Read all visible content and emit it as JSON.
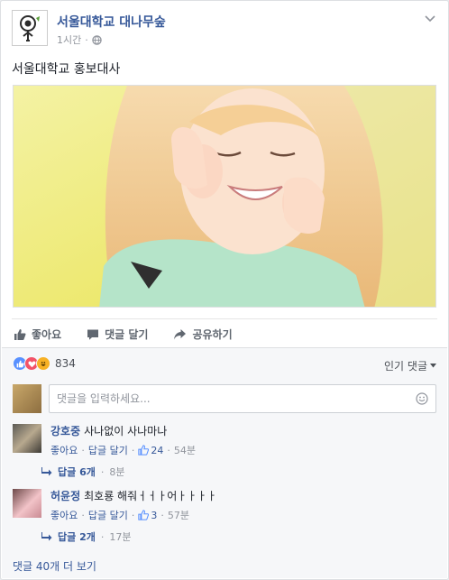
{
  "post": {
    "page_name": "서울대학교 대나무숲",
    "time": "1시간",
    "privacy_icon": "globe-icon",
    "text": "서울대학교 홍보대사"
  },
  "actions": {
    "like": "좋아요",
    "comment": "댓글 달기",
    "share": "공유하기"
  },
  "reactions": {
    "icons": [
      "like-icon",
      "love-icon",
      "haha-icon"
    ],
    "count": "834",
    "sort_label": "인기 댓글"
  },
  "composer": {
    "placeholder": "댓글을 입력하세요..."
  },
  "comments": [
    {
      "author": "강호중",
      "text": "사나없이 사나마나",
      "like_label": "좋아요",
      "reply_label": "답글 달기",
      "likes": "24",
      "time": "54분",
      "replies_label": "답글 6개",
      "replies_time": "8분"
    },
    {
      "author": "허윤정",
      "text": "최호룡 해줘ㅓㅓㅏ어ㅏㅏㅏㅏ",
      "like_label": "좋아요",
      "reply_label": "답글 달기",
      "likes": "3",
      "time": "57분",
      "replies_label": "답글 2개",
      "replies_time": "17분"
    }
  ],
  "more_comments": "댓글 40개 더 보기",
  "colors": {
    "link": "#365899",
    "like_blue": "#5890ff",
    "love_red": "#f25268",
    "haha_yellow": "#f7b125"
  }
}
